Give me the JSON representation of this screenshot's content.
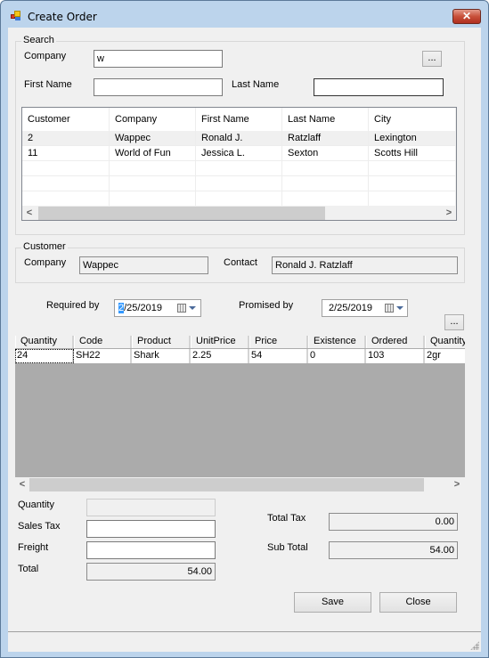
{
  "window": {
    "title": "Create Order",
    "close_glyph": "✕"
  },
  "search": {
    "group_label": "Search",
    "company_label": "Company",
    "company_value": "w",
    "browse_label": "...",
    "first_name_label": "First Name",
    "first_name_value": "",
    "last_name_label": "Last Name",
    "last_name_value": ""
  },
  "customer_grid": {
    "columns": [
      "Customer",
      "Company",
      "First Name",
      "Last Name",
      "City"
    ],
    "rows": [
      [
        "2",
        "Wappec",
        "Ronald J.",
        "Ratzlaff",
        "Lexington"
      ],
      [
        "11",
        "World of Fun",
        "Jessica L.",
        "Sexton",
        "Scotts Hill"
      ],
      [
        "",
        "",
        "",
        "",
        ""
      ],
      [
        "",
        "",
        "",
        "",
        ""
      ],
      [
        "",
        "",
        "",
        "",
        ""
      ]
    ],
    "selected_row": 0,
    "scroll_left": "<",
    "scroll_right": ">"
  },
  "customer": {
    "group_label": "Customer",
    "company_label": "Company",
    "company_value": "Wappec",
    "contact_label": "Contact",
    "contact_value": "Ronald J. Ratzlaff"
  },
  "dates": {
    "required_label": "Required by",
    "required_value_selected": "2",
    "required_value_rest": "/25/2019",
    "promised_label": "Promised by",
    "promised_value": "2/25/2019",
    "browse_label": "..."
  },
  "product_grid": {
    "columns": [
      "Quantity",
      "Code",
      "Product",
      "UnitPrice",
      "Price",
      "Existence",
      "Ordered",
      "Quantity"
    ],
    "rows": [
      [
        "24",
        "SH22",
        "Shark",
        "2.25",
        "54",
        "0",
        "103",
        "2gr"
      ]
    ],
    "scroll_left": "<",
    "scroll_right": ">"
  },
  "totals": {
    "quantity_label": "Quantity",
    "quantity_value": "",
    "sales_tax_label": "Sales Tax",
    "sales_tax_value": "",
    "freight_label": "Freight",
    "freight_value": "",
    "total_label": "Total",
    "total_value": "54.00",
    "total_tax_label": "Total Tax",
    "total_tax_value": "0.00",
    "sub_total_label": "Sub Total",
    "sub_total_value": "54.00"
  },
  "actions": {
    "save_label": "Save",
    "close_label": "Close"
  },
  "status": {
    "text": ""
  }
}
